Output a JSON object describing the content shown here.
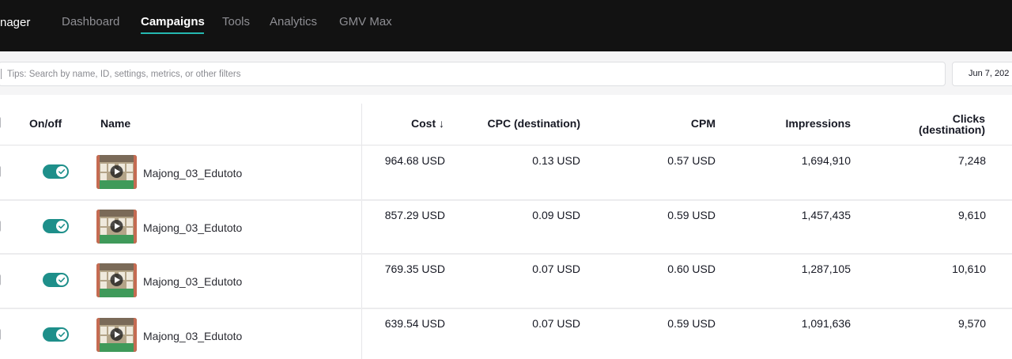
{
  "nav": {
    "brand": "nager",
    "items": [
      "Dashboard",
      "Campaigns",
      "Tools",
      "Analytics",
      "GMV Max"
    ],
    "active": "Campaigns"
  },
  "filters": {
    "search_placeholder": "Tips: Search by name, ID, settings, metrics, or other filters",
    "date": "Jun 7, 202"
  },
  "table": {
    "headers": {
      "onoff": "On/off",
      "name": "Name",
      "cost": "Cost ↓",
      "cpc": "CPC (destination)",
      "cpm": "CPM",
      "impressions": "Impressions",
      "clicks_line1": "Clicks",
      "clicks_line2": "(destination)"
    },
    "rows": [
      {
        "enabled": true,
        "name": "Majong_03_Edutoto",
        "cost": "964.68 USD",
        "cpc": "0.13 USD",
        "cpm": "0.57 USD",
        "impressions": "1,694,910",
        "clicks": "7,248"
      },
      {
        "enabled": true,
        "name": "Majong_03_Edutoto",
        "cost": "857.29 USD",
        "cpc": "0.09 USD",
        "cpm": "0.59 USD",
        "impressions": "1,457,435",
        "clicks": "9,610"
      },
      {
        "enabled": true,
        "name": "Majong_03_Edutoto",
        "cost": "769.35 USD",
        "cpc": "0.07 USD",
        "cpm": "0.60 USD",
        "impressions": "1,287,105",
        "clicks": "10,610"
      },
      {
        "enabled": true,
        "name": "Majong_03_Edutoto",
        "cost": "639.54 USD",
        "cpc": "0.07 USD",
        "cpm": "0.59 USD",
        "impressions": "1,091,636",
        "clicks": "9,570"
      }
    ]
  },
  "colors": {
    "nav_bg": "#121212",
    "accent": "#25b8b0",
    "toggle_on": "#1e8f8a"
  },
  "icons": {
    "toggle_knob": "check-icon",
    "thumbnail_overlay": "play-icon"
  }
}
